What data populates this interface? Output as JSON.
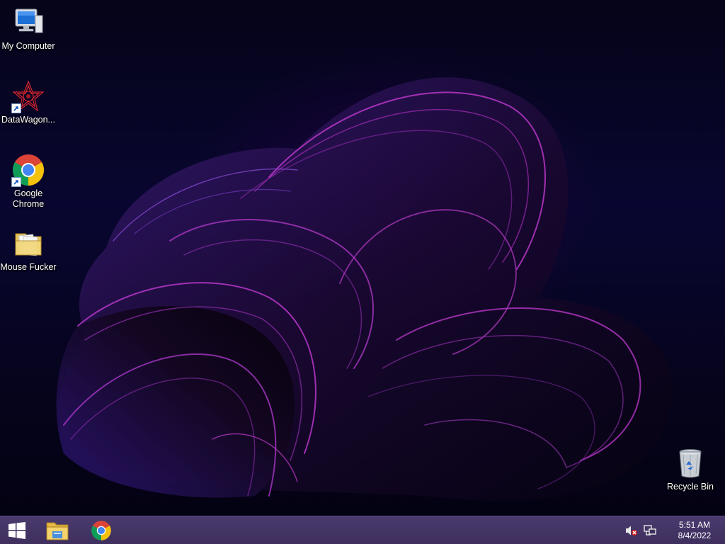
{
  "desktop": {
    "icons": [
      {
        "label": "My Computer",
        "icon": "computer-icon",
        "shortcut": false
      },
      {
        "label": "DataWagon...",
        "icon": "datawagon-icon",
        "shortcut": true
      },
      {
        "label": "Google Chrome",
        "icon": "chrome-icon",
        "shortcut": true
      },
      {
        "label": "Mouse Fucker",
        "icon": "folder-icon",
        "shortcut": false
      },
      {
        "label": "Recycle Bin",
        "icon": "recycle-bin-icon",
        "shortcut": false
      }
    ]
  },
  "taskbar": {
    "pinned": [
      {
        "icon": "start-windows-icon"
      },
      {
        "icon": "file-explorer-icon"
      },
      {
        "icon": "chrome-icon"
      }
    ],
    "tray": {
      "icons": [
        "volume-muted-icon",
        "network-icon"
      ],
      "time": "5:51 AM",
      "date": "8/4/2022"
    }
  },
  "colors": {
    "taskbar": "#4a3a6e",
    "wallpaper_base": "#06041c",
    "wallpaper_accent": "#c03ad0"
  }
}
